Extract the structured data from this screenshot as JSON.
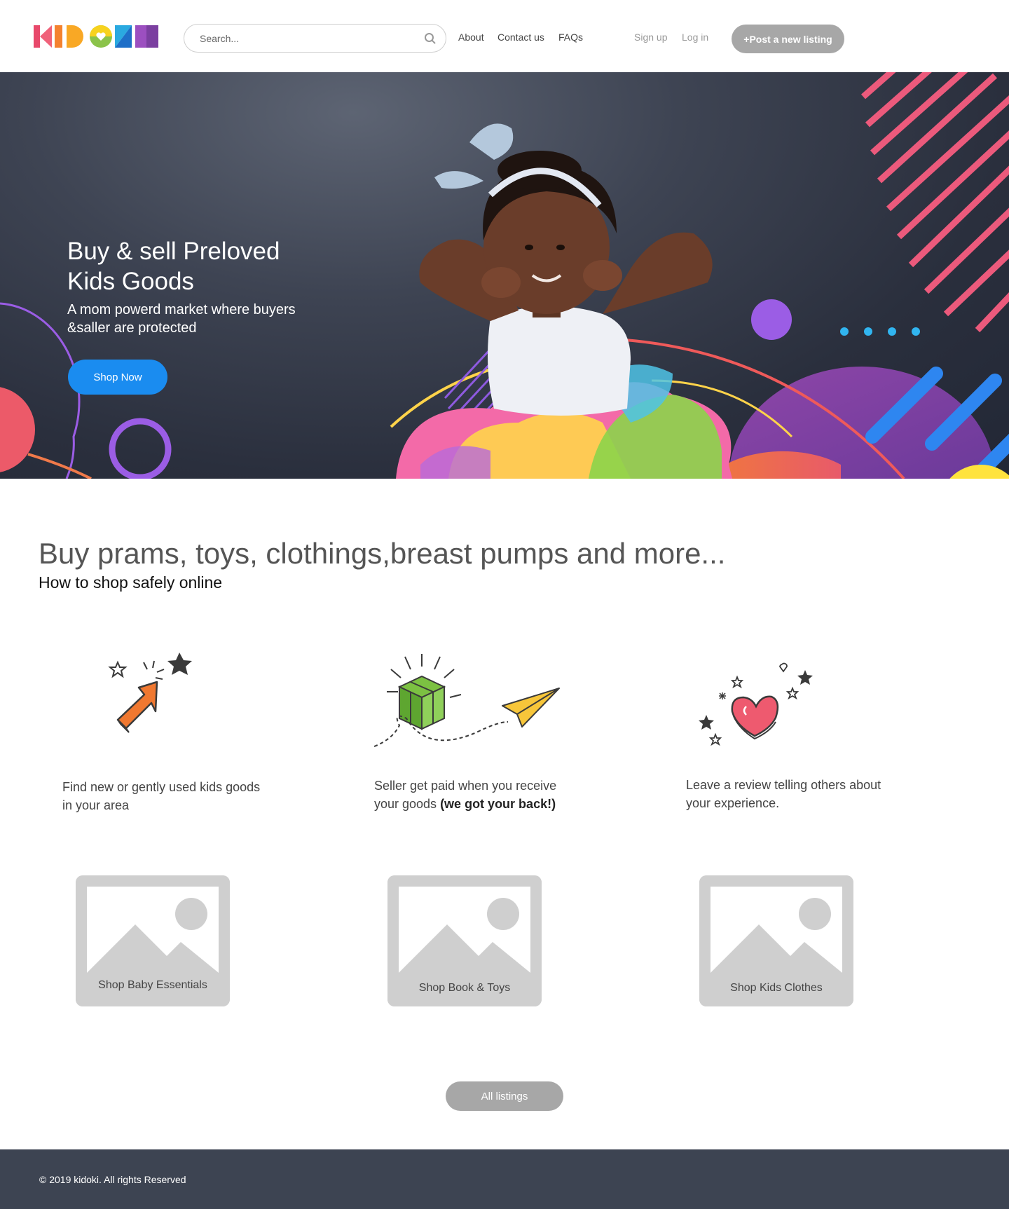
{
  "header": {
    "logo_text": "KIDOKI",
    "search_placeholder": "Search...",
    "nav": {
      "about": "About",
      "contact": "Contact us",
      "faqs": "FAQs"
    },
    "auth": {
      "signup": "Sign up",
      "login": "Log in"
    },
    "post_button": "+Post a new listing"
  },
  "hero": {
    "title": "Buy & sell Preloved Kids Goods",
    "subtitle": "A mom powerd market where buyers &saller are protected",
    "cta": "Shop Now"
  },
  "intro": {
    "heading": "Buy prams, toys, clothings,breast pumps and more...",
    "subheading": "How to shop safely online"
  },
  "steps": [
    {
      "text": "Find new or gently used kids goods in your area"
    },
    {
      "text": "Seller get paid when you receive your goods ",
      "bold": "(we got your back!)"
    },
    {
      "text": "Leave a review telling others about your experience."
    }
  ],
  "categories": [
    {
      "label": "Shop Baby Essentials"
    },
    {
      "label": "Shop Book & Toys"
    },
    {
      "label": "Shop Kids Clothes"
    }
  ],
  "all_listings": "All listings",
  "footer": {
    "copyright": "© 2019 kidoki. All rights Reserved"
  },
  "colors": {
    "accent_blue": "#1a8cf0",
    "button_gray": "#a7a7a7",
    "footer_bg": "#3d4452",
    "hero_pink": "#e85a7a",
    "hero_purple": "#9b5de5",
    "hero_yellow": "#ffe33d"
  },
  "icons": [
    "kidoki-logo",
    "search-icon",
    "cursor-arrow-icon",
    "gift-paper-plane-icon",
    "heart-stars-icon",
    "image-placeholder-icon",
    "copyright-icon"
  ]
}
